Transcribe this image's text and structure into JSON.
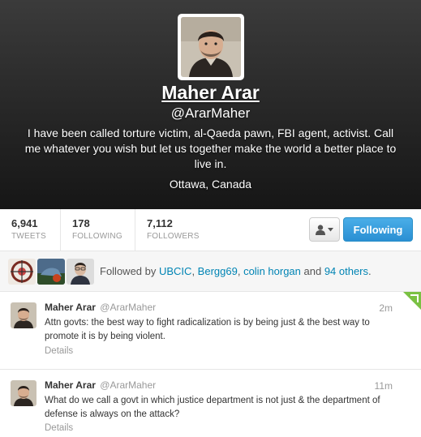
{
  "profile": {
    "name": "Maher Arar",
    "handle": "@ArarMaher",
    "bio": "I have been called torture victim, al-Qaeda pawn, FBI agent, activist. Call me whatever you wish but let us together make the world a better place to live in.",
    "location": "Ottawa, Canada"
  },
  "stats": {
    "tweets": {
      "value": "6,941",
      "label": "TWEETS"
    },
    "following": {
      "value": "178",
      "label": "FOLLOWING"
    },
    "followers": {
      "value": "7,112",
      "label": "FOLLOWERS"
    }
  },
  "actions": {
    "user_menu_icon": "person-dropdown-icon",
    "follow_label": "Following"
  },
  "followed_by": {
    "prefix": "Followed by ",
    "users": [
      "UBCIC",
      "Bergg69",
      "colin horgan"
    ],
    "others": "94 others",
    "sep1": ", ",
    "sep2": ", ",
    "and": " and ",
    "end": "."
  },
  "tweets": [
    {
      "name": "Maher Arar",
      "handle": "@ArarMaher",
      "time": "2m",
      "text": "Attn govts: the best way to fight radicalization is by being just & the best way to promote it is by being violent.",
      "details": "Details"
    },
    {
      "name": "Maher Arar",
      "handle": "@ArarMaher",
      "time": "11m",
      "text": "What do we call a govt in which justice department is not just & the department of defense is always on the attack?",
      "details": "Details"
    }
  ],
  "colors": {
    "accent": "#0084b4",
    "follow_button": "#2a8fd3",
    "header_bg": "#2a2a2a"
  }
}
